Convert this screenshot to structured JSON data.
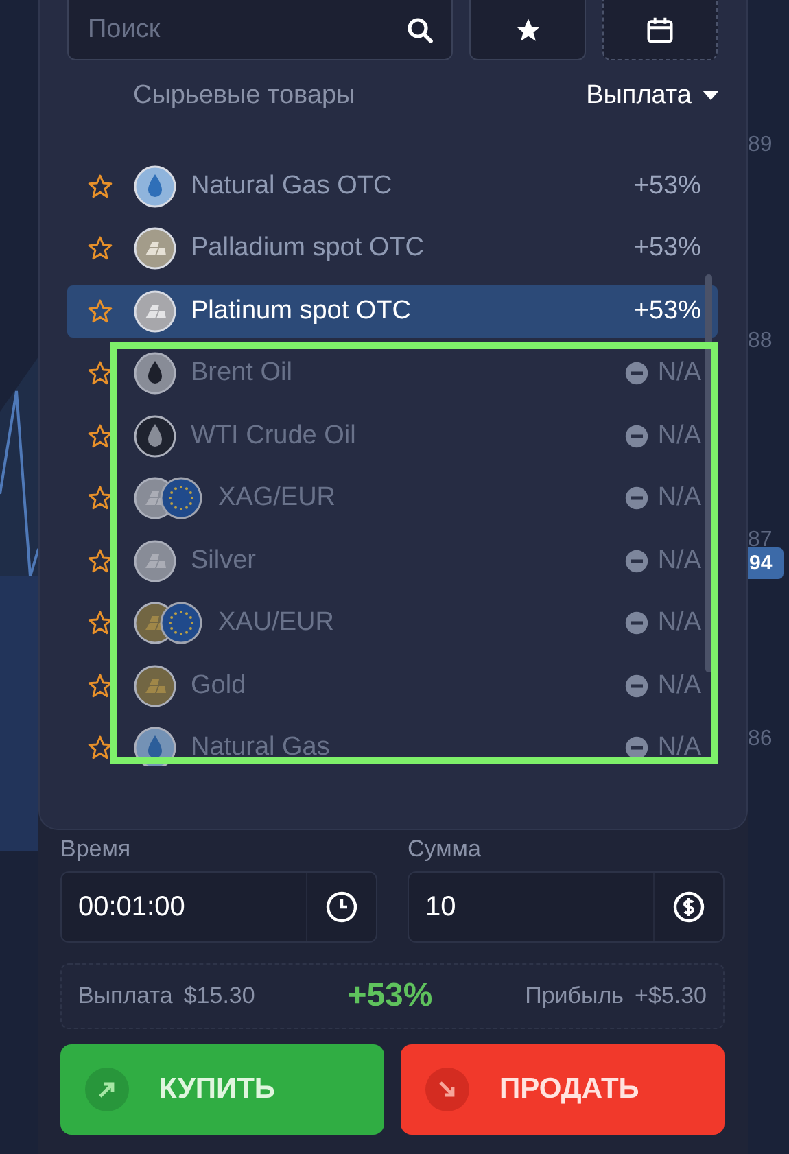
{
  "search": {
    "placeholder": "Поиск"
  },
  "category": "Сырьевые товары",
  "sort": {
    "label": "Выплата"
  },
  "assets": [
    {
      "name": "Natural Gas OTC",
      "payout": "+53%",
      "kind": "gas",
      "disabled": false,
      "selected": false
    },
    {
      "name": "Palladium spot OTC",
      "payout": "+53%",
      "kind": "palladium",
      "disabled": false,
      "selected": false
    },
    {
      "name": "Platinum spot OTC",
      "payout": "+53%",
      "kind": "platinum",
      "disabled": false,
      "selected": true
    },
    {
      "name": "Brent Oil",
      "payout": "N/A",
      "kind": "brent",
      "disabled": true,
      "selected": false
    },
    {
      "name": "WTI Crude Oil",
      "payout": "N/A",
      "kind": "wti",
      "disabled": true,
      "selected": false
    },
    {
      "name": "XAG/EUR",
      "payout": "N/A",
      "kind": "silverpair",
      "disabled": true,
      "selected": false
    },
    {
      "name": "Silver",
      "payout": "N/A",
      "kind": "silver",
      "disabled": true,
      "selected": false
    },
    {
      "name": "XAU/EUR",
      "payout": "N/A",
      "kind": "goldpair",
      "disabled": true,
      "selected": false
    },
    {
      "name": "Gold",
      "payout": "N/A",
      "kind": "gold",
      "disabled": true,
      "selected": false
    },
    {
      "name": "Natural Gas",
      "payout": "N/A",
      "kind": "gas",
      "disabled": true,
      "selected": false
    }
  ],
  "axis_labels": [
    "89",
    "88",
    "87",
    "86"
  ],
  "price_badge": "94",
  "time": {
    "label": "Время",
    "value": "00:01:00"
  },
  "amount": {
    "label": "Сумма",
    "value": "10"
  },
  "payout_info": {
    "payout_label": "Выплата",
    "payout_value": "$15.30",
    "percent": "+53%",
    "profit_label": "Прибыль",
    "profit_value": "+$5.30"
  },
  "buttons": [
    {
      "kind": "buy",
      "label": "КУПИТЬ"
    },
    {
      "kind": "sell",
      "label": "ПРОДАТЬ"
    }
  ]
}
